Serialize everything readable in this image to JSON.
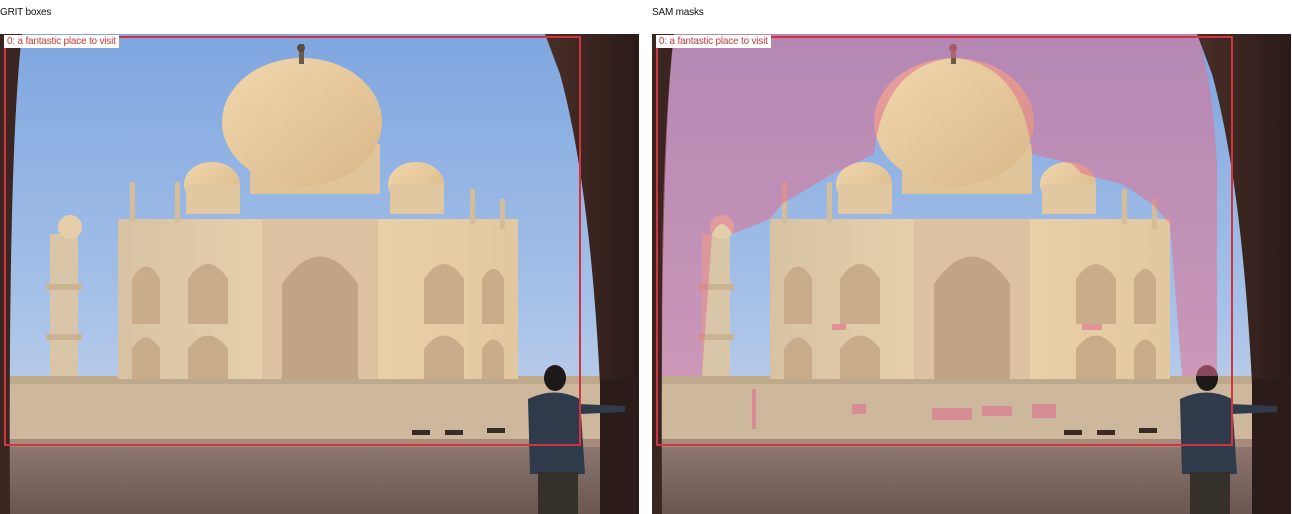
{
  "panels": {
    "left": {
      "title": "GRIT boxes"
    },
    "right": {
      "title": "SAM masks"
    }
  },
  "detection": {
    "label": "0: a fantastic place to visit"
  },
  "colors": {
    "box": "#d0343e",
    "mask": "#e07090",
    "label_text": "#c43a3a"
  },
  "scene": {
    "subject": "Taj Mahal mausoleum viewed through a red sandstone archway",
    "person": "man standing at right"
  }
}
